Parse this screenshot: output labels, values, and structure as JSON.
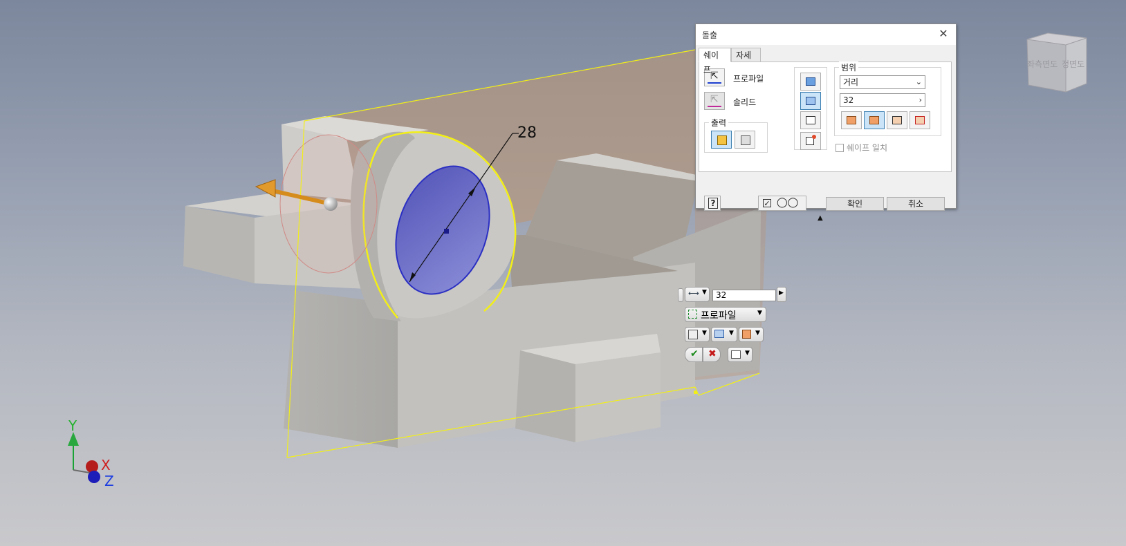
{
  "dialog": {
    "title": "돌출",
    "tabs": [
      {
        "label": "쉐이프"
      },
      {
        "label": "자세히"
      }
    ],
    "profile_label": "프로파일",
    "solid_label": "솔리드",
    "output_group": "출력",
    "range_group": "범위",
    "range_type": "거리",
    "range_value": "32",
    "match_shape_label": "쉐이프 일치",
    "ok_label": "확인",
    "cancel_label": "취소"
  },
  "minitoolbar": {
    "distance_value": "32",
    "profile_label": "프로파일"
  },
  "viewport": {
    "dimension_label": "28",
    "viewcube_left_face": "좌측면도",
    "viewcube_front_face": "정면도",
    "axes": {
      "x": "X",
      "y": "Y",
      "z": "Z"
    }
  },
  "colors": {
    "preview_outline": "#f2ef17",
    "extrude_preview": "#b99677",
    "hole_fill": "#6c6ec8",
    "selected_button": "#cce4f7"
  },
  "icons": {
    "profile": "cursor-arrow-icon",
    "solid": "cursor-arrow-gray-icon",
    "output_solid": "solid-cube-icon",
    "output_surface": "surface-cube-icon",
    "help": "help-icon",
    "preview": "glasses-icon"
  }
}
